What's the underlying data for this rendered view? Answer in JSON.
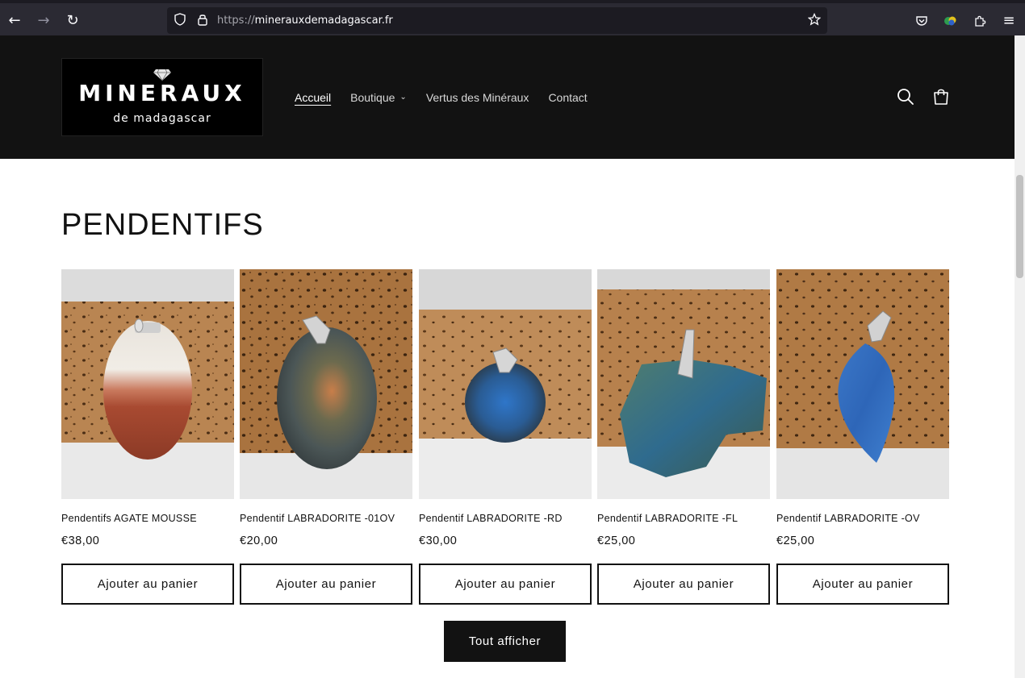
{
  "browser": {
    "url_protocol": "https://",
    "url_host": "minerauxdemadagascar.fr",
    "back_icon": "back-arrow-icon",
    "forward_icon": "forward-arrow-icon",
    "reload_icon": "reload-icon"
  },
  "header": {
    "logo_main": "MINERAUX",
    "logo_sub": "de madagascar",
    "nav": [
      {
        "label": "Accueil",
        "active": true
      },
      {
        "label": "Boutique",
        "dropdown": true
      },
      {
        "label": "Vertus des Minéraux"
      },
      {
        "label": "Contact"
      }
    ]
  },
  "section": {
    "title": "PENDENTIFS"
  },
  "products": [
    {
      "name": "Pendentifs AGATE MOUSSE",
      "price": "€38,00",
      "button": "Ajouter au panier"
    },
    {
      "name": "Pendentif LABRADORITE -01OV",
      "price": "€20,00",
      "button": "Ajouter au panier"
    },
    {
      "name": "Pendentif LABRADORITE -RD",
      "price": "€30,00",
      "button": "Ajouter au panier"
    },
    {
      "name": "Pendentif LABRADORITE -FL",
      "price": "€25,00",
      "button": "Ajouter au panier"
    },
    {
      "name": "Pendentif LABRADORITE -OV",
      "price": "€25,00",
      "button": "Ajouter au panier"
    }
  ],
  "view_all_label": "Tout afficher",
  "colors": {
    "header_bg": "#121212",
    "text": "#121212",
    "button_dark": "#121212"
  }
}
